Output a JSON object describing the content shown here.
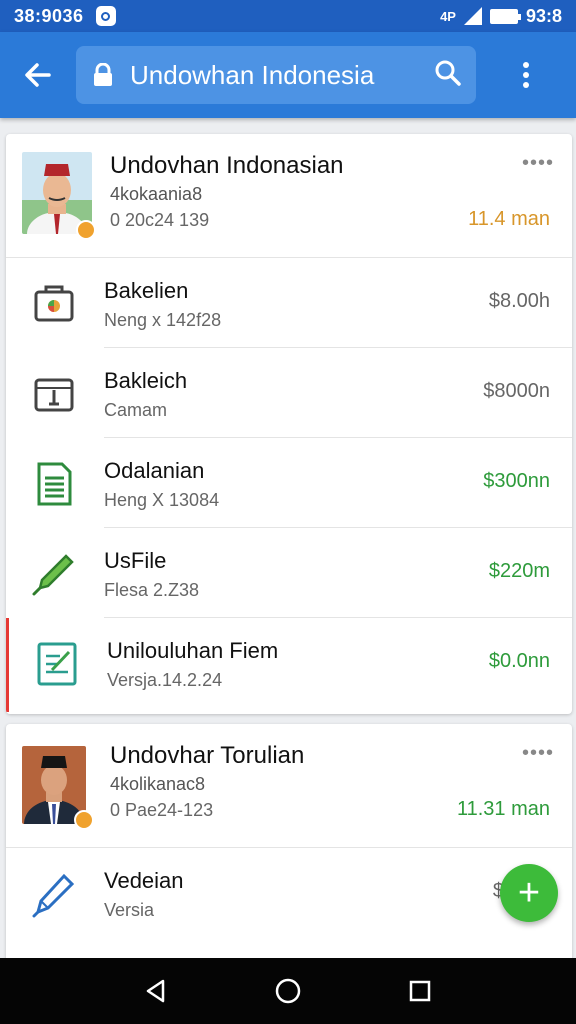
{
  "status_bar": {
    "time_left": "38:9036",
    "wifi_label": "4P",
    "time_right": "93:8",
    "icons": [
      "notification-icon",
      "wifi-icon",
      "signal-icon",
      "battery-icon"
    ]
  },
  "app_bar": {
    "title": "Undowhan Indonesia",
    "icons": [
      "back-arrow-icon",
      "lock-icon",
      "search-icon",
      "more-vert-icon"
    ],
    "color": "#2b7ad8"
  },
  "cards": [
    {
      "title": "Undovhan  Indonasian",
      "subtitle": "4kokaania8",
      "meta": "0 20c24  139",
      "amount": "11.4 man",
      "amount_color": "#d8962a",
      "menu": "••••",
      "items": [
        {
          "name": "Bakelien",
          "detail": "Neng x 142f28",
          "price": "$8.00h",
          "icon": "folder-icon"
        },
        {
          "name": "Bakleich",
          "detail": "Camam",
          "price": "$8000n",
          "icon": "box-download-icon"
        },
        {
          "name": "Odalanian",
          "detail": "Heng X 13084",
          "price": "$300nn",
          "icon": "spreadsheet-icon"
        },
        {
          "name": "UsFile",
          "detail": "Flesa 2.Z38",
          "price": "$220m",
          "icon": "marker-icon"
        },
        {
          "name": "Unilouluhan Fiem",
          "detail": "Versja.14.2.24",
          "price": "$0.0nn",
          "icon": "checklist-icon"
        }
      ]
    },
    {
      "title": "Undovhar Torulian",
      "subtitle": "4kolikanac8",
      "meta": "0 Pae24-123",
      "amount": "11.31 man",
      "amount_color": "#2e9b3b",
      "menu": "••••",
      "items": [
        {
          "name": "Vedeian",
          "detail": "Versia",
          "price": "$",
          "icon": "pen-icon"
        }
      ]
    }
  ],
  "fab": {
    "label": "+"
  },
  "nav_bar": {
    "icons": [
      "back-triangle-icon",
      "home-circle-icon",
      "recents-square-icon"
    ]
  }
}
